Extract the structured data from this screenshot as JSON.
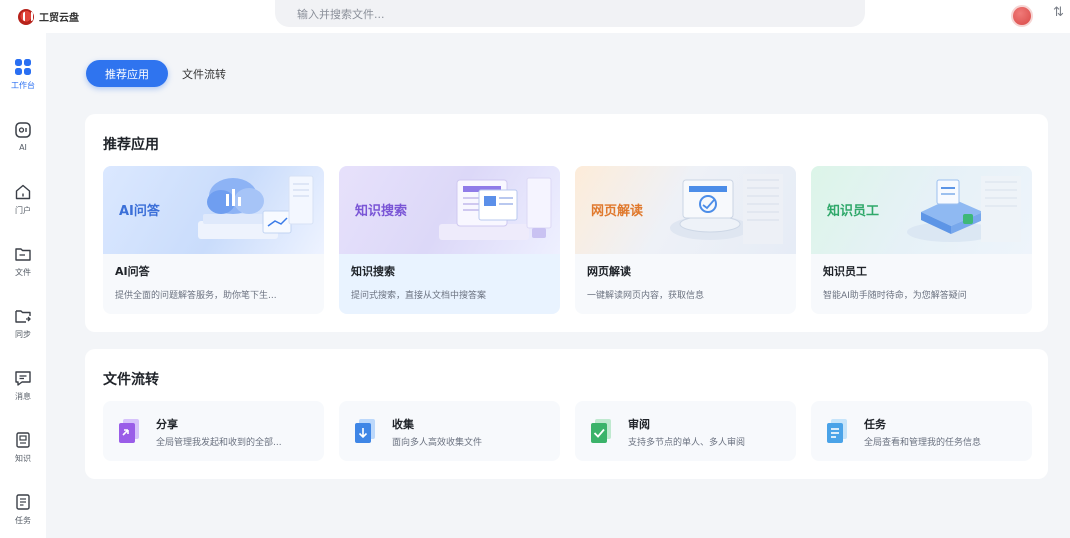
{
  "app": {
    "name": "工贸云盘"
  },
  "search": {
    "placeholder": "输入并搜索文件..."
  },
  "sidebar": {
    "items": [
      {
        "label": "工作台",
        "icon": "grid-icon"
      },
      {
        "label": "AI",
        "icon": "ai-icon"
      },
      {
        "label": "门户",
        "icon": "home-icon"
      },
      {
        "label": "文件",
        "icon": "folder-icon"
      },
      {
        "label": "同步",
        "icon": "sync-folder-icon"
      },
      {
        "label": "消息",
        "icon": "message-icon"
      },
      {
        "label": "知识",
        "icon": "knowledge-icon"
      },
      {
        "label": "任务",
        "icon": "task-icon"
      }
    ]
  },
  "tabs": [
    {
      "label": "推荐应用"
    },
    {
      "label": "文件流转"
    }
  ],
  "recommended": {
    "title": "推荐应用",
    "apps": [
      {
        "banner": "AI问答",
        "name": "AI问答",
        "desc": "提供全面的问题解答服务，助你笔下生...",
        "color": "#3b6fd8"
      },
      {
        "banner": "知识搜索",
        "name": "知识搜索",
        "desc": "提问式搜索，直接从文档中搜答案",
        "color": "#7a55d6"
      },
      {
        "banner": "网页解读",
        "name": "网页解读",
        "desc": "一键解读网页内容，获取信息",
        "color": "#e0792d"
      },
      {
        "banner": "知识员工",
        "name": "知识员工",
        "desc": "智能AI助手随时待命，为您解答疑问",
        "color": "#2fa86a"
      }
    ]
  },
  "flow": {
    "title": "文件流转",
    "items": [
      {
        "name": "分享",
        "desc": "全局管理我发起和收到的全部...",
        "color": "#9a5de8"
      },
      {
        "name": "收集",
        "desc": "面向多人高效收集文件",
        "color": "#3f86e6"
      },
      {
        "name": "审阅",
        "desc": "支持多节点的单人、多人审阅",
        "color": "#3bb36a"
      },
      {
        "name": "任务",
        "desc": "全局查看和管理我的任务信息",
        "color": "#4aa3e8"
      }
    ]
  }
}
